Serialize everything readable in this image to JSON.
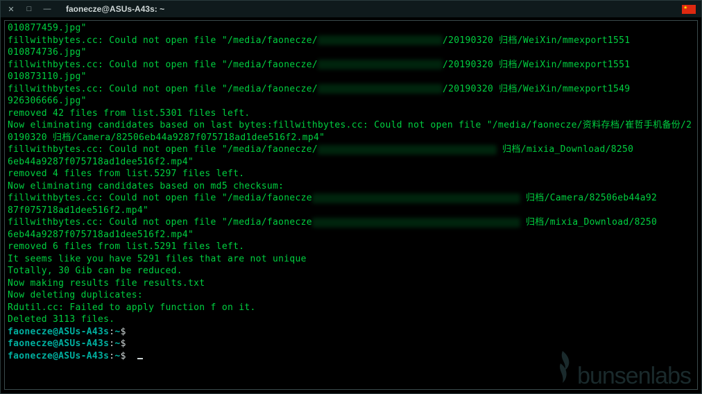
{
  "window": {
    "title": "faonecze@ASUs-A43s: ~"
  },
  "watermark": "bunsenlabs",
  "prompt": {
    "userhost": "faonecze@ASUs-A43s",
    "sep": ":",
    "path": "~",
    "symbol": "$"
  },
  "lines": [
    {
      "t": "plain",
      "text": "010877459.jpg\""
    },
    {
      "t": "redacted",
      "pre": "fillwithbytes.cc: Could not open file \"/media/faonecze/",
      "rw": 180,
      "post": "/20190320 归档/WeiXin/mmexport1551"
    },
    {
      "t": "plain",
      "text": "010874736.jpg\""
    },
    {
      "t": "redacted",
      "pre": "fillwithbytes.cc: Could not open file \"/media/faonecze/",
      "rw": 180,
      "post": "/20190320 归档/WeiXin/mmexport1551"
    },
    {
      "t": "plain",
      "text": "010873110.jpg\""
    },
    {
      "t": "redacted",
      "pre": "fillwithbytes.cc: Could not open file \"/media/faonecze/",
      "rw": 180,
      "post": "/20190320 归档/WeiXin/mmexport1549"
    },
    {
      "t": "plain",
      "text": "926306666.jpg\""
    },
    {
      "t": "plain",
      "text": "removed 42 files from list.5301 files left."
    },
    {
      "t": "plain",
      "text": "Now eliminating candidates based on last bytes:fillwithbytes.cc: Could not open file \"/media/faonecze/资料存档/崔哲手机备份/20190320 归档/Camera/82506eb44a9287f075718ad1dee516f2.mp4\""
    },
    {
      "t": "redacted",
      "pre": "fillwithbytes.cc: Could not open file \"/media/faonecze/",
      "rw": 258,
      "post": " 归档/mixia_Download/8250"
    },
    {
      "t": "plain",
      "text": "6eb44a9287f075718ad1dee516f2.mp4\""
    },
    {
      "t": "plain",
      "text": "removed 4 files from list.5297 files left."
    },
    {
      "t": "plain",
      "text": "Now eliminating candidates based on md5 checksum:"
    },
    {
      "t": "redacted",
      "pre": "fillwithbytes.cc: Could not open file \"/media/faonecze",
      "rw": 300,
      "post": " 归档/Camera/82506eb44a92"
    },
    {
      "t": "plain",
      "text": "87f075718ad1dee516f2.mp4\""
    },
    {
      "t": "redacted",
      "pre": "fillwithbytes.cc: Could not open file \"/media/faonecze",
      "rw": 300,
      "post": " 归档/mixia_Download/8250"
    },
    {
      "t": "plain",
      "text": "6eb44a9287f075718ad1dee516f2.mp4\""
    },
    {
      "t": "plain",
      "text": "removed 6 files from list.5291 files left."
    },
    {
      "t": "plain",
      "text": "It seems like you have 5291 files that are not unique"
    },
    {
      "t": "plain",
      "text": "Totally, 30 Gib can be reduced."
    },
    {
      "t": "plain",
      "text": "Now making results file results.txt"
    },
    {
      "t": "plain",
      "text": "Now deleting duplicates:"
    },
    {
      "t": "plain",
      "text": "Rdutil.cc: Failed to apply function f on it."
    },
    {
      "t": "plain",
      "text": "Deleted 3113 files."
    },
    {
      "t": "prompt"
    },
    {
      "t": "prompt"
    },
    {
      "t": "prompt_cursor"
    }
  ]
}
